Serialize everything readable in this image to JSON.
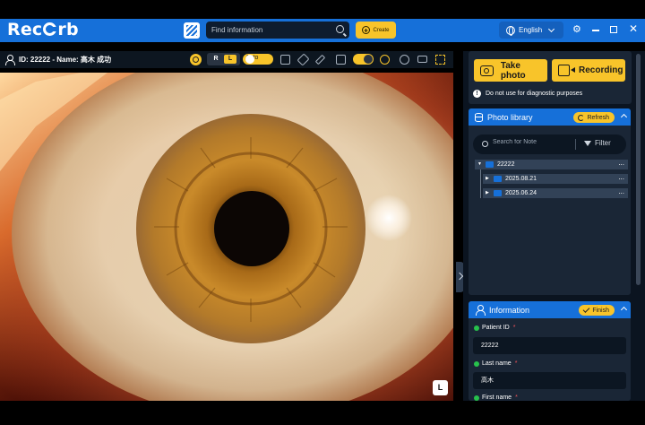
{
  "app": {
    "brand": "Recorb"
  },
  "topbar": {
    "search_placeholder": "Find information",
    "create_label": "Create",
    "language": "English"
  },
  "viewer": {
    "patient_title": "ID: 22222 - Name: 高木 成功",
    "eye_r": "R",
    "eye_l": "L",
    "auto_label": "Auto",
    "side_badge": "L"
  },
  "capture": {
    "take_photo": "Take photo",
    "recording": "Recording",
    "warning": "Do not use for diagnostic purposes"
  },
  "photo_library": {
    "title": "Photo library",
    "refresh": "Refresh",
    "search_placeholder": "Search for Note",
    "filter": "Filter",
    "tree": {
      "root": "22222",
      "children": [
        "2025.08.21",
        "2025.06.24"
      ],
      "more": "..."
    }
  },
  "information": {
    "title": "Information",
    "finish": "Finish",
    "fields": [
      {
        "label": "Patient ID",
        "value": "22222"
      },
      {
        "label": "Last name",
        "value": "高木"
      },
      {
        "label": "First name",
        "value": ""
      }
    ]
  },
  "colors": {
    "primary": "#1670d9",
    "accent": "#f8c42a",
    "panel": "#1a2636",
    "background": "#0b1420",
    "required": "#f0545b",
    "status_ok": "#27c24c"
  },
  "icons": [
    "search-icon",
    "plus-circle-icon",
    "globe-icon",
    "gear-icon",
    "minimize-icon",
    "maximize-icon",
    "close-icon",
    "user-icon",
    "camera-icon",
    "video-icon",
    "info-icon",
    "database-icon",
    "refresh-icon",
    "filter-icon",
    "folder-icon",
    "check-icon",
    "chevron-up-icon"
  ]
}
